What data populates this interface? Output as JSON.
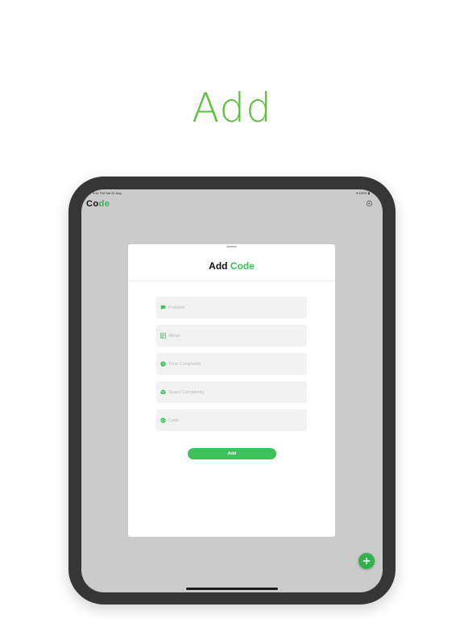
{
  "headline": "Add",
  "status": {
    "time": "9:41 PM  Sat 31 Aug",
    "battery": "▾ 100% ▮"
  },
  "app": {
    "title_prefix": "Co",
    "title_accent": "de"
  },
  "sheet": {
    "title_prefix": "Add ",
    "title_accent": "Code",
    "fields": [
      {
        "placeholder": "Problem",
        "icon": "message-icon"
      },
      {
        "placeholder": "About",
        "icon": "list-icon"
      },
      {
        "placeholder": "Time Complexity",
        "icon": "clock-icon"
      },
      {
        "placeholder": "Space Complexity",
        "icon": "cube-icon"
      },
      {
        "placeholder": "Code",
        "icon": "code-icon"
      }
    ],
    "submit_label": "Add"
  },
  "fab_icon": "plus-icon",
  "colors": {
    "accent": "#5ac13a",
    "button": "#3ec05b",
    "tablet": "#363636",
    "screen": "#cbcbcb"
  }
}
